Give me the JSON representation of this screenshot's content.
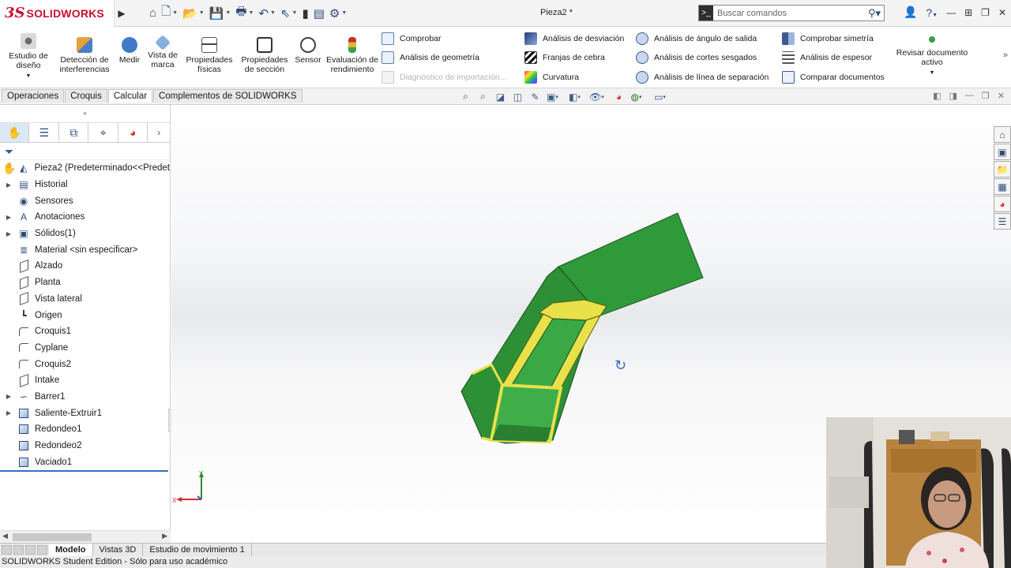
{
  "app": {
    "brand_prefix": "3S",
    "brand_name": "SOLIDWORKS",
    "document_title": "Pieza2 *",
    "search_placeholder": "Buscar comandos"
  },
  "ribbon": {
    "large_buttons": [
      {
        "id": "estudio",
        "label": "Estudio de diseño",
        "icon": "design-study-icon"
      },
      {
        "id": "interferencias",
        "label": "Detección de interferencias",
        "icon": "interference-icon"
      },
      {
        "id": "medir",
        "label": "Medir",
        "icon": "measure-icon"
      },
      {
        "id": "vista-marca",
        "label": "Vista de marca",
        "icon": "markup-icon"
      },
      {
        "id": "prop-fisicas",
        "label": "Propiedades físicas",
        "icon": "mass-properties-icon"
      },
      {
        "id": "prop-seccion",
        "label": "Propiedades de sección",
        "icon": "section-properties-icon"
      },
      {
        "id": "sensor",
        "label": "Sensor",
        "icon": "sensor-icon"
      },
      {
        "id": "rendimiento",
        "label": "Evaluación de rendimiento",
        "icon": "performance-icon"
      },
      {
        "id": "revisar",
        "label": "Revisar documento activo",
        "icon": "check-document-icon"
      }
    ],
    "col1": [
      {
        "label": "Comprobar",
        "icon": "check-icon",
        "disabled": false
      },
      {
        "label": "Análisis de geometría",
        "icon": "geometry-analysis-icon",
        "disabled": false
      },
      {
        "label": "Diagnóstico de importación...",
        "icon": "import-diagnostics-icon",
        "disabled": true
      }
    ],
    "col2": [
      {
        "label": "Análisis de desviación",
        "icon": "deviation-icon"
      },
      {
        "label": "Franjas de cebra",
        "icon": "zebra-icon"
      },
      {
        "label": "Curvatura",
        "icon": "curvature-icon"
      }
    ],
    "col3": [
      {
        "label": "Análisis de ángulo de salida",
        "icon": "draft-analysis-icon"
      },
      {
        "label": "Análisis de cortes sesgados",
        "icon": "undercut-icon"
      },
      {
        "label": "Análisis de línea de separación",
        "icon": "parting-line-icon"
      }
    ],
    "col4": [
      {
        "label": "Comprobar simetría",
        "icon": "symmetry-icon"
      },
      {
        "label": "Análisis de espesor",
        "icon": "thickness-icon"
      },
      {
        "label": "Comparar documentos",
        "icon": "compare-icon"
      }
    ]
  },
  "command_tabs": [
    {
      "label": "Operaciones",
      "active": false
    },
    {
      "label": "Croquis",
      "active": false
    },
    {
      "label": "Calcular",
      "active": true
    },
    {
      "label": "Complementos de SOLIDWORKS",
      "active": false
    }
  ],
  "feature_tree": [
    {
      "label": "Pieza2  (Predeterminado<<Predet",
      "icon": "part-icon",
      "expandable": false,
      "root": true
    },
    {
      "label": "Historial",
      "icon": "history-icon",
      "expandable": true
    },
    {
      "label": "Sensores",
      "icon": "sensor-folder-icon",
      "expandable": false
    },
    {
      "label": "Anotaciones",
      "icon": "annotations-icon",
      "expandable": true
    },
    {
      "label": "Sólidos(1)",
      "icon": "solid-bodies-icon",
      "expandable": true
    },
    {
      "label": "Material <sin especificar>",
      "icon": "material-icon",
      "expandable": false
    },
    {
      "label": "Alzado",
      "icon": "plane-icon",
      "expandable": false
    },
    {
      "label": "Planta",
      "icon": "plane-icon",
      "expandable": false
    },
    {
      "label": "Vista lateral",
      "icon": "plane-icon",
      "expandable": false
    },
    {
      "label": "Origen",
      "icon": "origin-icon",
      "expandable": false
    },
    {
      "label": "Croquis1",
      "icon": "sketch-icon",
      "expandable": false
    },
    {
      "label": "Cyplane",
      "icon": "sketch-icon",
      "expandable": false
    },
    {
      "label": "Croquis2",
      "icon": "sketch-icon",
      "expandable": false
    },
    {
      "label": "Intake",
      "icon": "plane-icon",
      "expandable": false
    },
    {
      "label": "Barrer1",
      "icon": "sweep-icon",
      "expandable": true
    },
    {
      "label": "Saliente-Extruir1",
      "icon": "extrude-icon",
      "expandable": true
    },
    {
      "label": "Redondeo1",
      "icon": "fillet-icon",
      "expandable": false
    },
    {
      "label": "Redondeo2",
      "icon": "fillet-icon",
      "expandable": false
    },
    {
      "label": "Vaciado1",
      "icon": "shell-icon",
      "expandable": false
    }
  ],
  "bottom_tabs": [
    {
      "label": "Modelo",
      "active": true
    },
    {
      "label": "Vistas 3D",
      "active": false
    },
    {
      "label": "Estudio de movimiento 1",
      "active": false
    }
  ],
  "status_text": "SOLIDWORKS Student Edition - Sólo para uso académico",
  "colors": {
    "part_green": "#2f9a3a",
    "part_edge_yellow": "#e8e14a",
    "brand_red": "#c8102e",
    "selection_blue": "#2f72c0"
  }
}
